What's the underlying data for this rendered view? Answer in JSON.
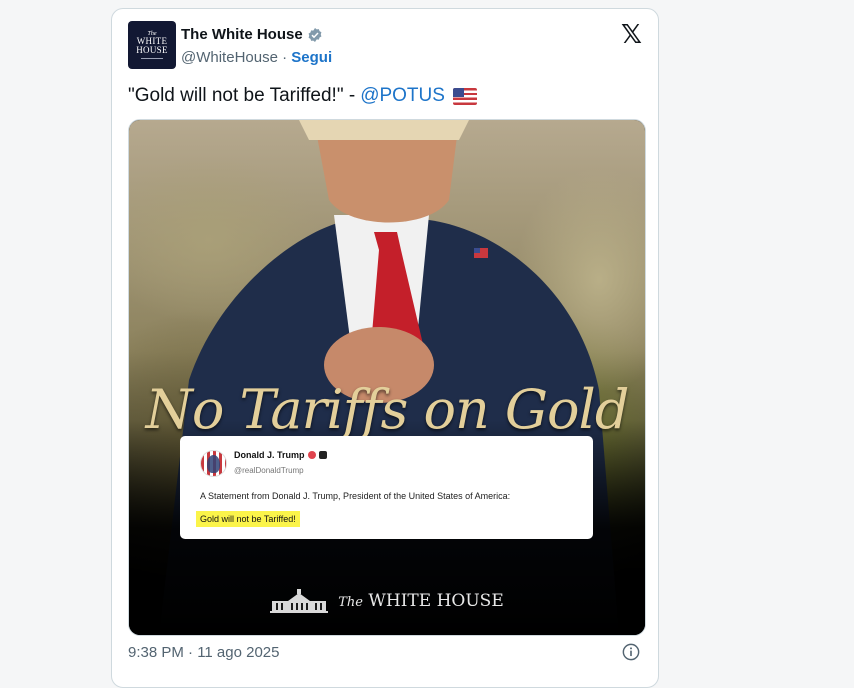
{
  "tweet": {
    "account": {
      "avatar_line1": "The",
      "avatar_line2": "WHITE",
      "avatar_line3": "HOUSE",
      "name": "The White House",
      "handle": "@WhiteHouse",
      "separator": "·",
      "follow_label": "Segui",
      "verified_icon": "verified-badge-icon"
    },
    "platform_icon": "x-logo-icon",
    "text": "\"Gold will not be Tariffed!\" -",
    "mention": "@POTUS",
    "emoji": "us-flag-emoji",
    "media": {
      "headline": "No Tariffs on Gold",
      "embedded_post": {
        "author": "Donald J. Trump",
        "handle": "@realDonaldTrump",
        "statement": "A Statement from Donald J. Trump, President of the United States of America:",
        "highlight": "Gold will not be Tariffed!"
      },
      "logo_text_the": "The",
      "logo_text_main": "WHITE HOUSE"
    },
    "timestamp": "9:38 PM · 11 ago 2025",
    "info_icon": "info-icon"
  },
  "colors": {
    "link": "#1d74c9",
    "verified": "#829aab",
    "headline_gold": "#e3cf9a",
    "highlight": "#fbf44a"
  }
}
